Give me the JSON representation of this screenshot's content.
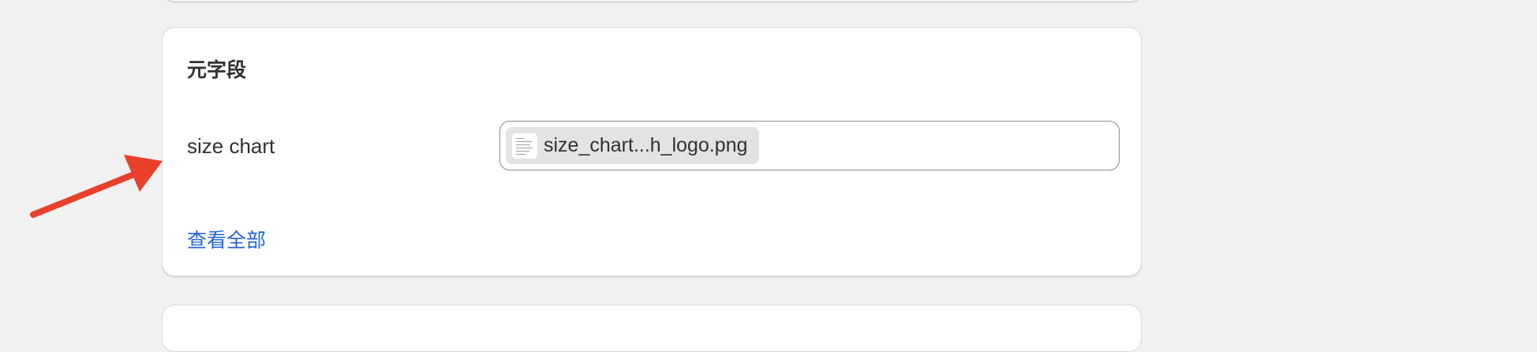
{
  "section": {
    "title": "元字段"
  },
  "field": {
    "label": "size chart",
    "file_name": "size_chart...h_logo.png",
    "file_icon": "image-thumbnail-icon"
  },
  "actions": {
    "view_all_label": "查看全部"
  },
  "annotation": {
    "arrow_color": "#e8402a"
  },
  "colors": {
    "link": "#2463d1",
    "background": "#f1f1f1"
  }
}
